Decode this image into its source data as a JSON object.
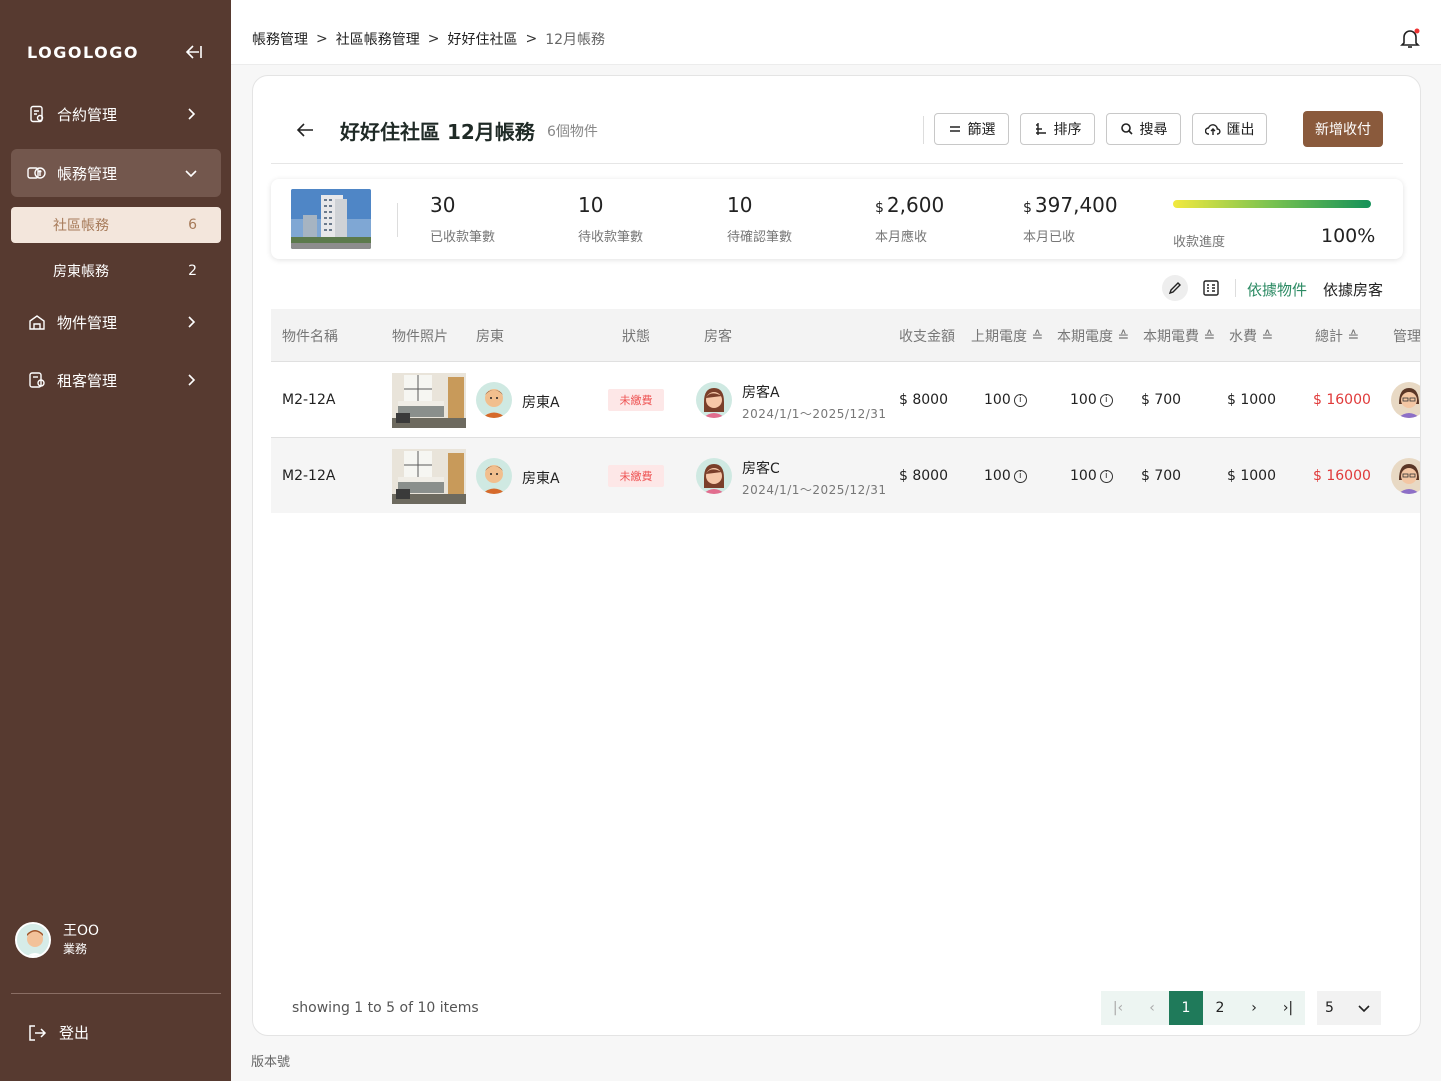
{
  "sidebar": {
    "logo": "LOGOLOGO",
    "items": [
      {
        "label": "合約管理"
      },
      {
        "label": "帳務管理"
      },
      {
        "label": "物件管理"
      },
      {
        "label": "租客管理"
      }
    ],
    "sub_items": [
      {
        "label": "社區帳務",
        "count": "6"
      },
      {
        "label": "房東帳務",
        "count": "2"
      }
    ],
    "user": {
      "name": "王OO",
      "role": "業務"
    },
    "logout": "登出"
  },
  "breadcrumb": [
    "帳務管理",
    "社區帳務管理",
    "好好住社區",
    "12月帳務"
  ],
  "header": {
    "title": "好好住社區 12月帳務",
    "count": "6個物件",
    "filter": "篩選",
    "sort": "排序",
    "search": "搜尋",
    "export": "匯出",
    "add": "新增收付"
  },
  "stats": {
    "collected_count": {
      "value": "30",
      "label": "已收款筆數"
    },
    "pending_count": {
      "value": "10",
      "label": "待收款筆數"
    },
    "confirm_count": {
      "value": "10",
      "label": "待確認筆數"
    },
    "receivable": {
      "currency": "$",
      "value": "2,600",
      "label": "本月應收"
    },
    "received": {
      "currency": "$",
      "value": "397,400",
      "label": "本月已收"
    },
    "progress": {
      "label": "收款進度",
      "value": "100%",
      "fraction": 1.0
    }
  },
  "view_tabs": {
    "by_property": "依據物件",
    "by_tenant": "依據房客"
  },
  "table": {
    "headers": {
      "name": "物件名稱",
      "photo": "物件照片",
      "landlord": "房東",
      "status": "狀態",
      "tenant": "房客",
      "amount": "收支金額",
      "prev_elec": "上期電度",
      "cur_elec": "本期電度",
      "elec_fee": "本期電費",
      "water": "水費",
      "total": "總計",
      "manager": "管理者"
    },
    "rows": [
      {
        "name": "M2-12A",
        "landlord": "房東A",
        "status": "未繳費",
        "tenant": "房客A",
        "period": "2024/1/1～2025/12/31",
        "amount": "$ 8000",
        "prev_elec": "100",
        "cur_elec": "100",
        "elec_fee": "$ 700",
        "water": "$ 1000",
        "total": "$ 16000"
      },
      {
        "name": "M2-12A",
        "landlord": "房東A",
        "status": "未繳費",
        "tenant": "房客C",
        "period": "2024/1/1～2025/12/31",
        "amount": "$ 8000",
        "prev_elec": "100",
        "cur_elec": "100",
        "elec_fee": "$ 700",
        "water": "$ 1000",
        "total": "$ 16000"
      }
    ]
  },
  "pagination": {
    "showing": "showing 1 to 5 of 10 items",
    "pages": [
      "1",
      "2"
    ],
    "current": "1",
    "per_page": "5"
  },
  "footer": "版本號",
  "colors": {
    "sidebar": "#573a30",
    "primary": "#1f7a5a",
    "add_button": "#8a5a3c",
    "unpaid": "#e03a3a"
  }
}
